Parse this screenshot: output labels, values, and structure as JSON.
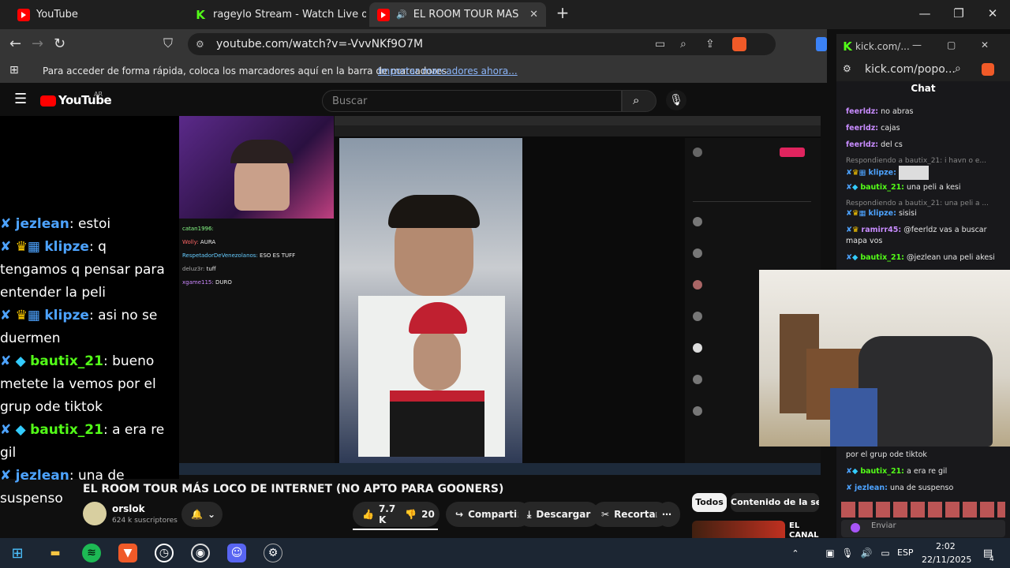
{
  "tabs": [
    {
      "title": "YouTube"
    },
    {
      "title": "rageylo Stream - Watch Live on Kick"
    },
    {
      "title": "EL ROOM TOUR MÁS LOCO D"
    }
  ],
  "address": {
    "url": "youtube.com/watch?v=-VvvNKf9O7M"
  },
  "bookmarks": {
    "text": "Para acceder de forma rápida, coloca los marcadores aquí en la barra de marcadores",
    "link": "Importar marcadores ahora..."
  },
  "youtube": {
    "logo": "YouTube",
    "country": "AR",
    "search_placeholder": "Buscar"
  },
  "left_chat": [
    {
      "user": "jezlean",
      "text": ": estoi",
      "color": "blue"
    },
    {
      "user": "klipze",
      "text": ": q tengamos q pensar para entender la peli",
      "color": "blue"
    },
    {
      "user": "klipze",
      "text": ": asi no se duermen",
      "color": "blue"
    },
    {
      "user": "bautix_21",
      "text": ": bueno metete la vemos por el grup ode tiktok",
      "color": "green"
    },
    {
      "user": "bautix_21",
      "text": ": a era re gil",
      "color": "green"
    },
    {
      "user": "jezlean",
      "text": ": una de suspenso",
      "color": "blue"
    }
  ],
  "stream_chat": [
    {
      "user": "catan1996:",
      "text": ""
    },
    {
      "user": "Wolly:",
      "text": "AURA"
    },
    {
      "user": "RespetadorDeVenezolanos:",
      "text": "ESO ES TUFF"
    },
    {
      "user": "deluz3r:",
      "text": "tuff"
    },
    {
      "user": "xgame115:",
      "text": "DURO"
    }
  ],
  "video": {
    "title": "EL ROOM TOUR MÁS LOCO DE INTERNET (NO APTO PARA GOONERS)",
    "channel": "orslok",
    "subs": "624 k suscriptores",
    "likes": "7.7 K",
    "dislikes": "20",
    "share": "Compartir",
    "download": "Descargar",
    "clip": "Recortar"
  },
  "chips": {
    "all": "Todos",
    "series": "Contenido de la serie"
  },
  "rec": {
    "title": "EL CANAL CALIENTE"
  },
  "kick": {
    "title": "kick.com/...",
    "url": "kick.com/popo...",
    "header": "Chat",
    "messages": [
      {
        "user": "feerldz:",
        "text": "no abras",
        "reply": ""
      },
      {
        "user": "feerldz:",
        "text": "cajas",
        "reply": ""
      },
      {
        "user": "feerldz:",
        "text": "del cs",
        "reply": ""
      },
      {
        "user": "klipze:",
        "text": "",
        "reply": "Respondiendo a bautix_21: i havn o e..."
      },
      {
        "user": "bautix_21:",
        "text": "una peli a kesi",
        "reply": ""
      },
      {
        "user": "klipze:",
        "text": "sisisi",
        "reply": "Respondiendo a bautix_21: una peli a ..."
      },
      {
        "user": "ramirr45:",
        "text": "@feerldz vas a buscar mapa vos",
        "reply": ""
      },
      {
        "user": "bautix_21:",
        "text": "@jezlean una peli akesi",
        "reply": ""
      }
    ],
    "bottom_messages": [
      {
        "user": "",
        "text": "por el grup ode tiktok"
      },
      {
        "user": "bautix_21:",
        "text": "a era re gil"
      },
      {
        "user": "jezlean:",
        "text": "una de suspenso"
      }
    ],
    "send": "Enviar"
  },
  "taskbar": {
    "lang": "ESP",
    "time": "2:02",
    "date": "22/11/2025",
    "notif": "4"
  }
}
